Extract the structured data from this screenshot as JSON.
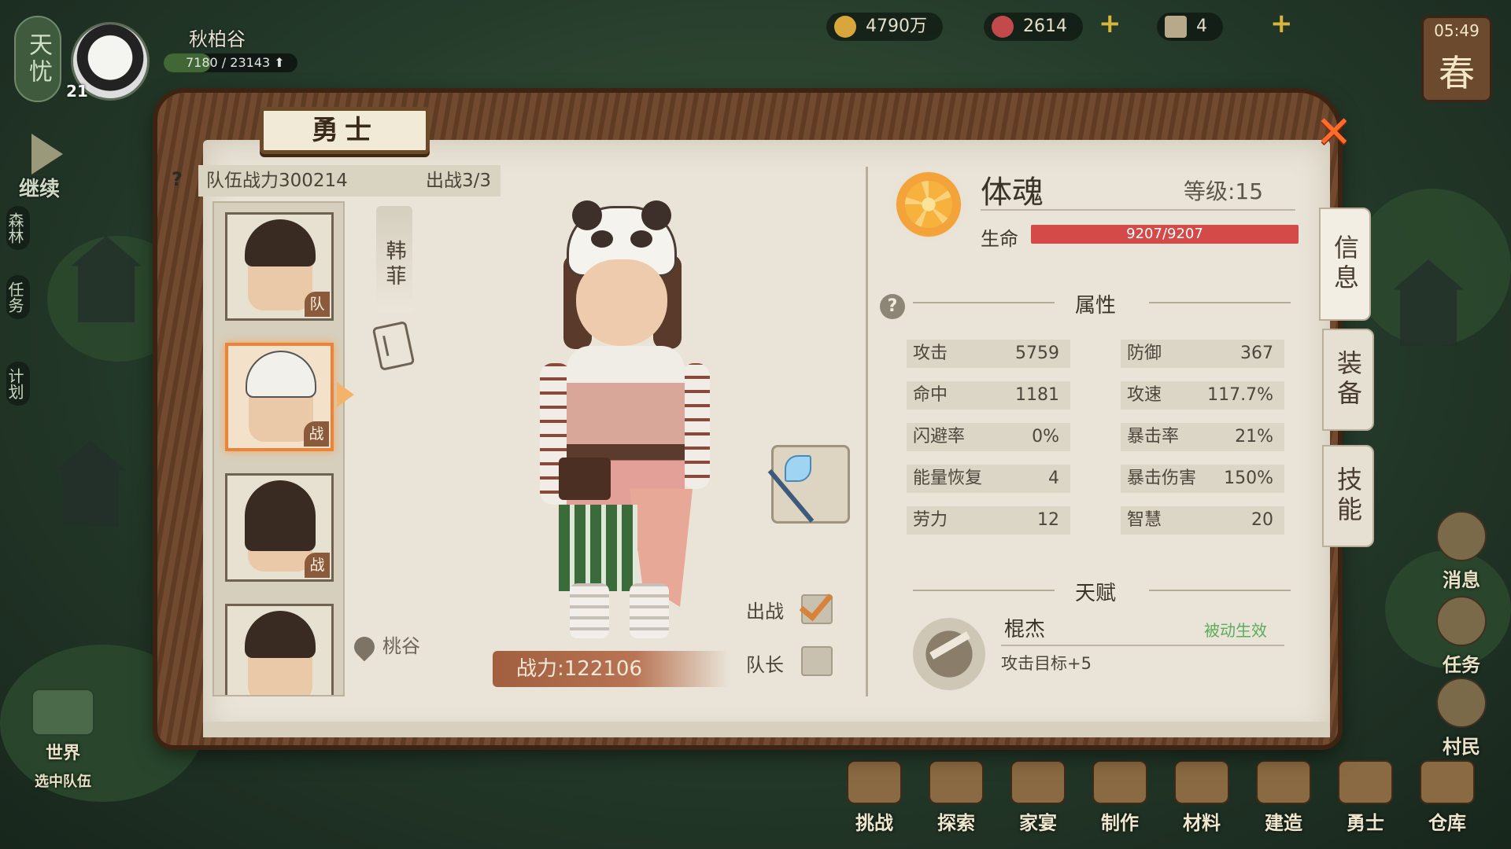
{
  "hud": {
    "badge": "天忧",
    "player_name": "秋柏谷",
    "player_level": "21",
    "exp_text": "7180 / 23143 ⬆",
    "continue_label": "继续",
    "forest_label": "森林",
    "task_label": "任务",
    "plan_label": "计划"
  },
  "resources": {
    "coins": "4790万",
    "flowers": "2614",
    "tickets": "4"
  },
  "clock": {
    "time": "05:49",
    "season": "春"
  },
  "panel": {
    "title": "勇士",
    "team_power": "队伍战力300214",
    "deploy": "出战3/3",
    "character_name": "韩菲",
    "location": "桃谷",
    "power": "战力:122106",
    "deploy_label": "出战",
    "captain_label": "队长",
    "roster": [
      {
        "tag": "队"
      },
      {
        "tag": "战"
      },
      {
        "tag": "战"
      },
      {
        "tag": ""
      }
    ]
  },
  "stats_panel": {
    "soul_name": "体魂",
    "level": "等级:15",
    "hp_label": "生命",
    "hp_text": "9207/9207",
    "hp_fraction": 1.0,
    "attributes_title": "属性",
    "attributes": [
      {
        "name": "攻击",
        "value": "5759"
      },
      {
        "name": "防御",
        "value": "367"
      },
      {
        "name": "命中",
        "value": "1181"
      },
      {
        "name": "攻速",
        "value": "117.7%"
      },
      {
        "name": "闪避率",
        "value": "0%"
      },
      {
        "name": "暴击率",
        "value": "21%"
      },
      {
        "name": "能量恢复",
        "value": "4"
      },
      {
        "name": "暴击伤害",
        "value": "150%"
      },
      {
        "name": "劳力",
        "value": "12"
      },
      {
        "name": "智慧",
        "value": "20"
      }
    ],
    "talent_title": "天赋",
    "talent_name": "棍杰",
    "talent_status": "被动生效",
    "talent_desc": "攻击目标+5"
  },
  "tabs": [
    "信息",
    "装备",
    "技能"
  ],
  "right_menu": [
    "消息",
    "任务",
    "村民"
  ],
  "bottom_menu": [
    "挑战",
    "探索",
    "家宴",
    "制作",
    "材料",
    "建造",
    "勇士",
    "仓库"
  ],
  "left_menu": [
    "世界",
    "选中队伍"
  ],
  "colors": {
    "hp": "#d34a48",
    "accent": "#e8843e",
    "talent_active": "#5cab5c"
  }
}
